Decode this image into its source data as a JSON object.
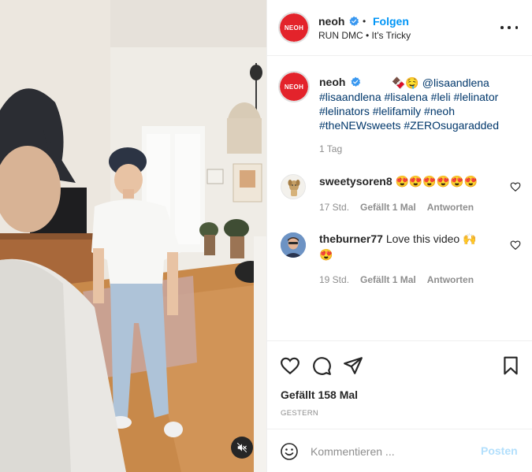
{
  "header": {
    "username": "neoh",
    "follow_label": "Folgen",
    "separator": "•",
    "audio": "RUN DMC • It's Tricky",
    "avatar_logo": "NEOH"
  },
  "caption": {
    "username": "neoh",
    "emoji": "🍫🤤",
    "mention": "@lisaandlena",
    "lines": [
      "#lisaandlena #lisalena #leli #lelinator",
      "#lelinators #lelifamily #neoh",
      "#theNEWsweets #ZEROsugaradded"
    ],
    "time": "1 Tag"
  },
  "comments": [
    {
      "username": "sweetysoren8",
      "text": "😍😍😍😍😍😍",
      "time": "17 Std.",
      "likes": "Gefällt 1 Mal",
      "reply": "Antworten"
    },
    {
      "username": "theburner77",
      "text": "Love this video 🙌",
      "text2": "😍",
      "time": "19 Std.",
      "likes": "Gefällt 1 Mal",
      "reply": "Antworten"
    }
  ],
  "actions": {
    "like_icon": "heart-icon",
    "comment_icon": "comment-icon",
    "share_icon": "share-icon",
    "save_icon": "bookmark-icon"
  },
  "likes_label": "Gefällt 158 Mal",
  "date_label": "GESTERN",
  "add_comment": {
    "placeholder": "Kommentieren ...",
    "post_label": "Posten"
  },
  "colors": {
    "accent_blue": "#0095f6",
    "post_disabled": "#b2dffc",
    "brand_red": "#e3232b",
    "muted_text": "#8e8e8e"
  }
}
